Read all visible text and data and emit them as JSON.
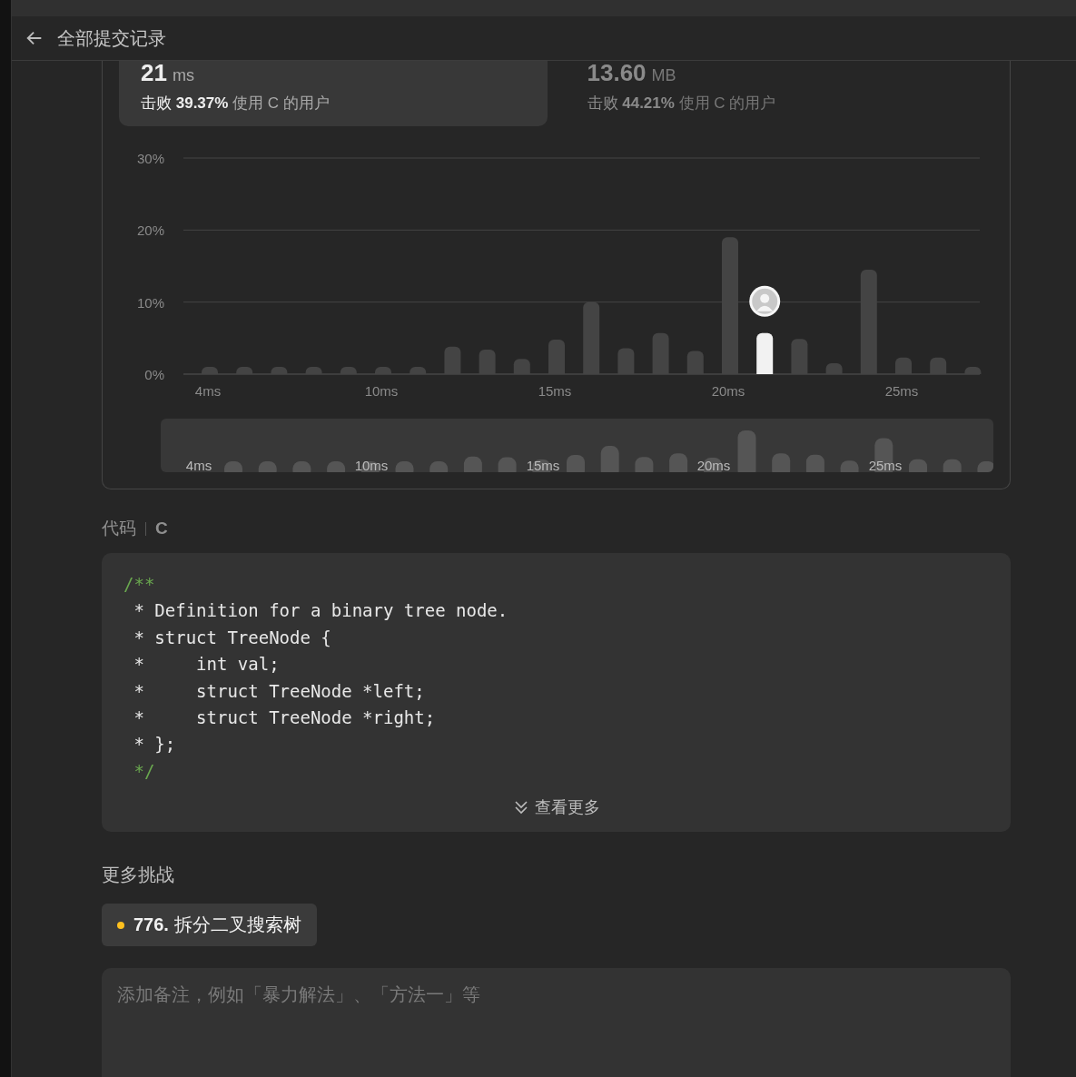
{
  "header": {
    "title": "全部提交记录"
  },
  "stats": [
    {
      "value": "21",
      "unit": "ms",
      "beat": "击败",
      "percent": "39.37%",
      "suffix": "使用 C 的用户",
      "selected": true
    },
    {
      "value": "13.60",
      "unit": "MB",
      "beat": "击败",
      "percent": "44.21%",
      "suffix": "使用 C 的用户",
      "selected": false
    }
  ],
  "chart": {
    "chart_data": {
      "type": "bar",
      "categories": [
        "4ms",
        null,
        null,
        null,
        null,
        "10ms",
        null,
        null,
        null,
        null,
        "15ms",
        null,
        null,
        null,
        null,
        "20ms",
        null,
        null,
        null,
        null,
        "25ms",
        null,
        null
      ],
      "stacked": true,
      "series": [
        {
          "color": "#444444",
          "values": [
            1,
            1,
            1,
            1,
            1,
            1,
            1,
            3.8,
            3.4,
            2.1,
            4.8,
            10,
            3.6,
            5.7,
            3.2,
            19,
            null,
            4.9,
            1.5,
            14.5,
            2.3,
            2.3,
            1
          ]
        },
        {
          "color": "#f2f2f2",
          "values": [
            null,
            null,
            null,
            null,
            null,
            null,
            null,
            null,
            null,
            null,
            null,
            null,
            null,
            null,
            null,
            null,
            5.7,
            null,
            null,
            null,
            null,
            null,
            null
          ]
        }
      ],
      "yticks": [
        {
          "value": 0,
          "label": "0%"
        },
        {
          "value": 10,
          "label": "10%"
        },
        {
          "value": 20,
          "label": "20%"
        },
        {
          "value": 30,
          "label": "30%"
        }
      ],
      "ylim": [
        0,
        30
      ]
    }
  },
  "overview": {
    "labels": [
      "4ms",
      "10ms",
      "15ms",
      "20ms",
      "25ms"
    ]
  },
  "code": {
    "label": "代码",
    "language": "C",
    "more": "查看更多",
    "lines": [
      {
        "kind": "delim",
        "text": "/**"
      },
      {
        "kind": "body",
        "text": " * Definition for a binary tree node."
      },
      {
        "kind": "body",
        "text": " * struct TreeNode {"
      },
      {
        "kind": "body",
        "text": " *     int val;"
      },
      {
        "kind": "body",
        "text": " *     struct TreeNode *left;"
      },
      {
        "kind": "body",
        "text": " *     struct TreeNode *right;"
      },
      {
        "kind": "body",
        "text": " * };"
      },
      {
        "kind": "delim",
        "text": " */"
      }
    ]
  },
  "more_challenges": {
    "title": "更多挑战",
    "items": [
      {
        "number": "776.",
        "title": "拆分二叉搜索树",
        "color": "#ffc01e"
      }
    ]
  },
  "note": {
    "placeholder": "添加备注，例如「暴力解法」、「方法一」等"
  }
}
